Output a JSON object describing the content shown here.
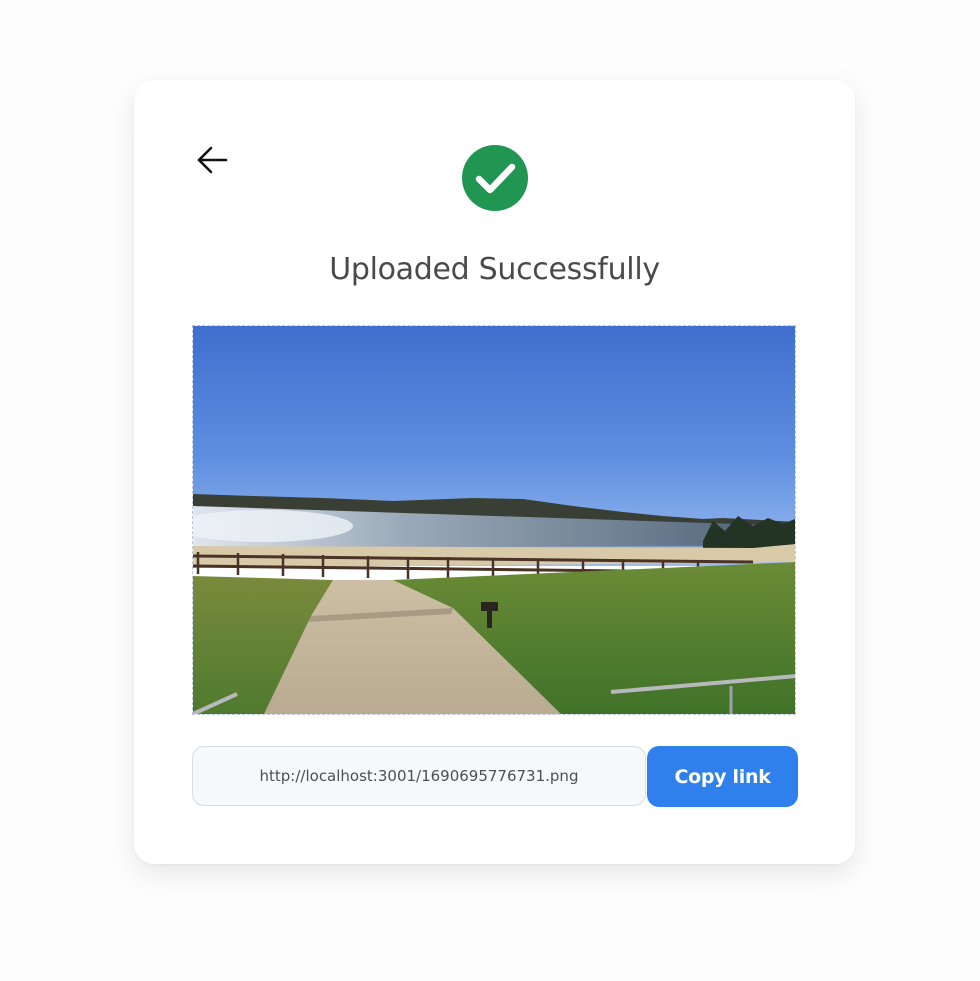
{
  "page": {
    "title": "Uploaded Successfully",
    "back_icon": "arrow-left-icon",
    "status_icon": "check-circle-icon"
  },
  "image_preview": {
    "alt": "Lakeside beach with concrete path and fence under blue sky"
  },
  "share": {
    "url": "http://localhost:3001/1690695776731.png",
    "copy_label": "Copy link"
  },
  "colors": {
    "success": "#219653",
    "accent": "#2f80ed",
    "title": "#4a4a4a"
  }
}
